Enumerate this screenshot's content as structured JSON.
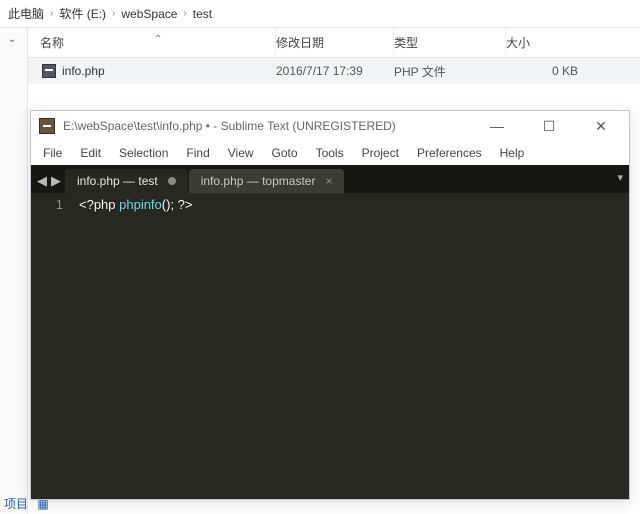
{
  "explorer": {
    "breadcrumb": [
      "此电脑",
      "软件 (E:)",
      "webSpace",
      "test"
    ],
    "columns": {
      "name": "名称",
      "date": "修改日期",
      "type": "类型",
      "size": "大小"
    },
    "rows": [
      {
        "name": "info.php",
        "date": "2016/7/17 17:39",
        "type": "PHP 文件",
        "size": "0 KB"
      }
    ],
    "footer": "项目"
  },
  "sublime": {
    "title": "E:\\webSpace\\test\\info.php • - Sublime Text (UNREGISTERED)",
    "menu": [
      "File",
      "Edit",
      "Selection",
      "Find",
      "View",
      "Goto",
      "Tools",
      "Project",
      "Preferences",
      "Help"
    ],
    "tabs": [
      {
        "label": "info.php — test",
        "active": true,
        "dirty": true
      },
      {
        "label": "info.php — topmaster",
        "active": false,
        "dirty": false
      }
    ],
    "code": {
      "line_no": "1",
      "open": "<?php ",
      "func": "phpinfo",
      "rest": "(); ?>"
    }
  }
}
